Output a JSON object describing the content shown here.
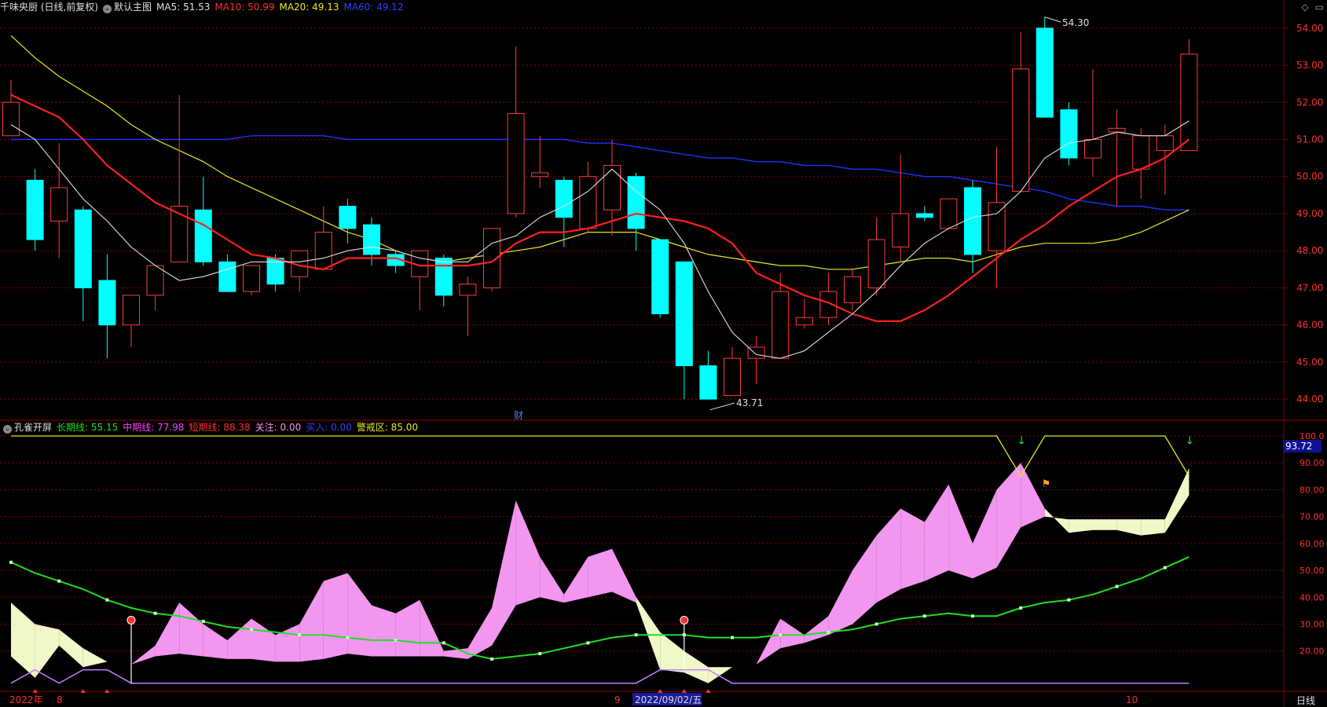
{
  "header_main": {
    "title": "千味央厨 (日线,前复权)",
    "template": "默认主图",
    "ma5_label": "MA5: 51.53",
    "ma10_label": "MA10: 50.99",
    "ma20_label": "MA20: 49.13",
    "ma60_label": "MA60: 49.12"
  },
  "header_sub": {
    "title": "孔雀开屏",
    "long_label": "长期线: 55.15",
    "mid_label": "中期线: 77.98",
    "short_label": "短期线: 88.38",
    "focus_label": "关注: 0.00",
    "buy_label": "买入: 0.00",
    "warn_label": "警戒区: 85.00"
  },
  "colors": {
    "up": "#ff3b3b",
    "down": "#00ffff",
    "ma5": "#e0e0e0",
    "ma10": "#ff2020",
    "ma20": "#e8e820",
    "ma60": "#2030ff",
    "long": "#1ee01e",
    "pink": "#f296f0",
    "cream": "#f0f8c8",
    "grid": "#8b0000"
  },
  "price_axis": {
    "min": 43.6,
    "max": 54.25,
    "ticks": [
      "54.00",
      "53.00",
      "52.00",
      "51.00",
      "50.00",
      "49.00",
      "48.00",
      "47.00",
      "46.00",
      "45.00",
      "44.00"
    ]
  },
  "sub_axis": {
    "min": 5,
    "max": 100,
    "ticks": [
      "100.0",
      "90.00",
      "80.00",
      "70.00",
      "60.00",
      "50.00",
      "40.00",
      "30.00",
      "20.00"
    ]
  },
  "current_value_badge": "93.72",
  "high_marker": "54.30",
  "low_marker": "43.71",
  "finance_marker": "财",
  "period_label": "日线",
  "date_labels": [
    "2022年",
    "8",
    "9",
    "2022/09/02/五",
    "10"
  ],
  "topright_icons": [
    "diamond-icon",
    "minimize-icon"
  ],
  "candles": [
    [
      51.1,
      52.0,
      51.1,
      52.6
    ],
    [
      49.9,
      48.3,
      48.0,
      50.2
    ],
    [
      48.8,
      49.7,
      47.8,
      50.9
    ],
    [
      49.1,
      47.0,
      46.1,
      49.2
    ],
    [
      47.2,
      46.0,
      45.1,
      47.9
    ],
    [
      46.0,
      46.8,
      45.4,
      46.8
    ],
    [
      46.8,
      47.6,
      46.4,
      47.6
    ],
    [
      47.7,
      49.2,
      47.7,
      52.2
    ],
    [
      49.1,
      47.7,
      47.6,
      50.0
    ],
    [
      47.7,
      46.9,
      46.9,
      47.9
    ],
    [
      46.9,
      47.6,
      46.8,
      47.6
    ],
    [
      47.8,
      47.1,
      46.9,
      47.9
    ],
    [
      47.3,
      48.0,
      46.9,
      48.0
    ],
    [
      47.5,
      48.5,
      47.5,
      49.2
    ],
    [
      49.2,
      48.6,
      48.2,
      49.4
    ],
    [
      48.7,
      47.9,
      47.6,
      48.9
    ],
    [
      47.9,
      47.6,
      47.4,
      48.0
    ],
    [
      47.3,
      48.0,
      46.4,
      48.0
    ],
    [
      47.8,
      46.8,
      46.5,
      47.9
    ],
    [
      46.8,
      47.1,
      45.7,
      47.3
    ],
    [
      47.0,
      48.6,
      46.9,
      48.6
    ],
    [
      49.0,
      51.7,
      48.9,
      53.5
    ],
    [
      50.0,
      50.1,
      49.7,
      51.1
    ],
    [
      49.9,
      48.9,
      48.1,
      50.0
    ],
    [
      48.6,
      50.0,
      48.5,
      50.4
    ],
    [
      49.1,
      50.3,
      48.4,
      51.0
    ],
    [
      50.0,
      48.6,
      48.0,
      50.1
    ],
    [
      48.3,
      46.3,
      46.2,
      48.3
    ],
    [
      47.7,
      44.9,
      44.0,
      47.7
    ],
    [
      44.9,
      44.0,
      44.0,
      45.3
    ],
    [
      44.1,
      45.1,
      44.1,
      45.4
    ],
    [
      45.1,
      45.4,
      44.4,
      45.7
    ],
    [
      45.1,
      46.9,
      45.1,
      47.4
    ],
    [
      46.0,
      46.2,
      45.9,
      46.7
    ],
    [
      46.2,
      46.9,
      46.0,
      47.4
    ],
    [
      46.6,
      47.3,
      46.4,
      47.5
    ],
    [
      47.0,
      48.3,
      46.8,
      48.9
    ],
    [
      48.1,
      49.0,
      47.7,
      50.6
    ],
    [
      49.0,
      48.9,
      48.8,
      49.2
    ],
    [
      48.6,
      49.4,
      48.6,
      49.3
    ],
    [
      49.7,
      47.9,
      47.4,
      49.9
    ],
    [
      48.0,
      49.3,
      47.0,
      50.8
    ],
    [
      49.6,
      52.9,
      49.6,
      53.9
    ],
    [
      54.0,
      51.6,
      51.6,
      54.3
    ],
    [
      51.8,
      50.5,
      50.3,
      52.0
    ],
    [
      50.5,
      51.0,
      50.0,
      52.9
    ],
    [
      51.2,
      51.3,
      49.2,
      51.8
    ],
    [
      50.2,
      51.1,
      49.4,
      51.3
    ],
    [
      50.7,
      51.1,
      49.5,
      51.4
    ],
    [
      50.7,
      53.3,
      50.7,
      53.7
    ]
  ],
  "ma_series": {
    "ma5": [
      51.4,
      51.0,
      50.2,
      49.4,
      48.8,
      48.1,
      47.6,
      47.2,
      47.3,
      47.5,
      47.7,
      47.7,
      47.7,
      47.8,
      48.0,
      48.1,
      48.0,
      47.8,
      47.7,
      47.7,
      48.2,
      48.4,
      48.9,
      49.2,
      49.6,
      50.2,
      49.6,
      49.1,
      48.2,
      46.9,
      45.8,
      45.2,
      45.1,
      45.3,
      45.8,
      46.3,
      46.9,
      47.6,
      48.2,
      48.6,
      48.9,
      49.0,
      49.6,
      50.5,
      50.9,
      51.0,
      51.2,
      51.1,
      51.1,
      51.5
    ],
    "ma10": [
      52.2,
      51.9,
      51.6,
      51.0,
      50.3,
      49.8,
      49.3,
      49.0,
      48.7,
      48.3,
      47.9,
      47.8,
      47.6,
      47.5,
      47.8,
      47.8,
      47.8,
      47.6,
      47.6,
      47.6,
      47.7,
      48.2,
      48.5,
      48.5,
      48.6,
      48.8,
      49.0,
      48.9,
      48.8,
      48.6,
      48.2,
      47.4,
      47.1,
      46.8,
      46.6,
      46.3,
      46.1,
      46.1,
      46.4,
      46.8,
      47.3,
      47.8,
      48.3,
      48.7,
      49.2,
      49.6,
      50.0,
      50.2,
      50.5,
      51.0
    ],
    "ma20": [
      53.8,
      53.2,
      52.7,
      52.3,
      51.9,
      51.4,
      51.0,
      50.7,
      50.4,
      50.0,
      49.7,
      49.4,
      49.1,
      48.8,
      48.5,
      48.3,
      48.0,
      47.8,
      47.7,
      47.8,
      47.9,
      48.0,
      48.1,
      48.3,
      48.5,
      48.5,
      48.5,
      48.3,
      48.1,
      47.9,
      47.8,
      47.7,
      47.6,
      47.6,
      47.5,
      47.5,
      47.6,
      47.7,
      47.8,
      47.8,
      47.7,
      47.9,
      48.1,
      48.2,
      48.2,
      48.2,
      48.3,
      48.5,
      48.8,
      49.1
    ],
    "ma60": [
      51.0,
      51.0,
      51.0,
      51.0,
      51.0,
      51.0,
      51.0,
      51.0,
      51.0,
      51.0,
      51.1,
      51.1,
      51.1,
      51.1,
      51.0,
      51.0,
      51.0,
      51.0,
      51.0,
      51.0,
      51.0,
      51.0,
      51.0,
      51.0,
      50.9,
      50.9,
      50.8,
      50.7,
      50.6,
      50.5,
      50.5,
      50.4,
      50.4,
      50.3,
      50.3,
      50.2,
      50.2,
      50.1,
      50.0,
      50.0,
      49.9,
      49.8,
      49.7,
      49.6,
      49.4,
      49.3,
      49.2,
      49.2,
      49.1,
      49.1
    ]
  },
  "sub_series": {
    "long": [
      53,
      49,
      46,
      43,
      39,
      36,
      34,
      33,
      31,
      29,
      28,
      27,
      26,
      26,
      25,
      24,
      24,
      23,
      23,
      19,
      17,
      18,
      19,
      21,
      23,
      25,
      26,
      26,
      26,
      25,
      25,
      25,
      26,
      26,
      27,
      28,
      30,
      32,
      33,
      34,
      33,
      33,
      36,
      38,
      39,
      41,
      44,
      47,
      51,
      55
    ],
    "mid": [
      38,
      30,
      28,
      21,
      16,
      15,
      22,
      38,
      30,
      24,
      32,
      26,
      30,
      46,
      49,
      37,
      34,
      39,
      20,
      21,
      36,
      76,
      55,
      41,
      55,
      58,
      40,
      27,
      20,
      14,
      14,
      15,
      32,
      26,
      33,
      50,
      63,
      73,
      68,
      82,
      60,
      80,
      90,
      73,
      64,
      65,
      65,
      63,
      64,
      78
    ],
    "short": [
      18,
      10,
      22,
      14,
      16,
      15,
      18,
      19,
      18,
      17,
      17,
      16,
      16,
      17,
      19,
      18,
      18,
      18,
      18,
      17,
      22,
      37,
      40,
      38,
      40,
      42,
      38,
      13,
      12,
      8,
      14,
      15,
      21,
      23,
      26,
      30,
      38,
      43,
      46,
      50,
      47,
      51,
      66,
      70,
      69,
      69,
      69,
      69,
      69,
      88
    ],
    "warn": [
      100,
      100,
      100,
      100,
      100,
      100,
      100,
      100,
      100,
      100,
      100,
      100,
      100,
      100,
      100,
      100,
      100,
      100,
      100,
      100,
      100,
      100,
      100,
      100,
      100,
      100,
      100,
      100,
      100,
      100,
      100,
      100,
      100,
      100,
      100,
      100,
      100,
      100,
      100,
      100,
      100,
      100,
      85,
      100,
      100,
      100,
      100,
      100,
      100,
      85
    ],
    "purple": [
      8,
      13,
      8,
      13,
      13,
      8,
      8,
      8,
      8,
      8,
      8,
      8,
      8,
      8,
      8,
      8,
      8,
      8,
      8,
      8,
      8,
      8,
      8,
      8,
      8,
      8,
      8,
      13,
      13,
      13,
      8,
      8,
      8,
      8,
      8,
      8,
      8,
      8,
      8,
      8,
      8,
      8,
      8,
      8,
      8,
      8,
      8,
      8,
      8,
      8
    ]
  }
}
